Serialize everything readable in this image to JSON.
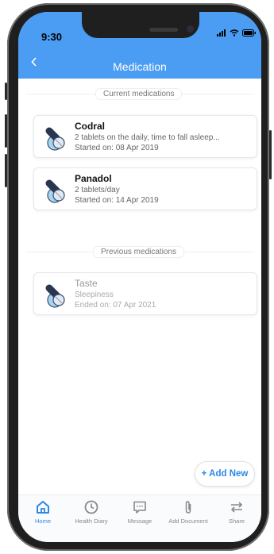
{
  "status_bar": {
    "time": "9:30"
  },
  "header": {
    "title": "Medication"
  },
  "sections": {
    "current_label": "Current medications",
    "previous_label": "Previous medications"
  },
  "current_meds": [
    {
      "name": "Codral",
      "dose": "2 tablets on the daily, time to fall asleep...",
      "date": "Started on: 08 Apr 2019"
    },
    {
      "name": "Panadol",
      "dose": "2 tablets/day",
      "date": "Started on: 14 Apr 2019"
    }
  ],
  "previous_meds": [
    {
      "name": "Taste",
      "dose": "Sleepiness",
      "date": "Ended on: 07 Apr 2021"
    }
  ],
  "add_button": {
    "label": "+ Add New"
  },
  "tabs": [
    {
      "label": "Home",
      "icon": "home-icon",
      "active": true
    },
    {
      "label": "Health Diary",
      "icon": "clock-icon",
      "active": false
    },
    {
      "label": "Message",
      "icon": "message-icon",
      "active": false
    },
    {
      "label": "Add Document",
      "icon": "paperclip-icon",
      "active": false
    },
    {
      "label": "Share",
      "icon": "share-icon",
      "active": false
    }
  ],
  "colors": {
    "header": "#4a9df2",
    "accent": "#2b88e6"
  }
}
